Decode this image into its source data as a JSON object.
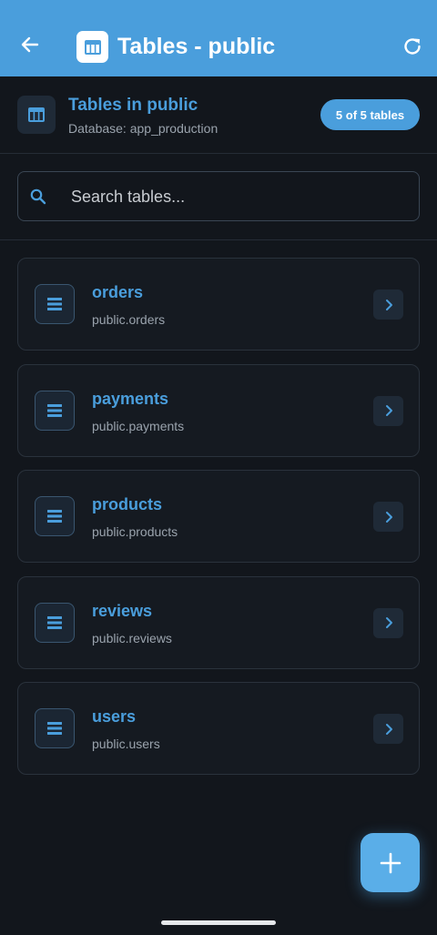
{
  "appbar": {
    "title": "Tables - public",
    "back_icon": "arrow-left-icon",
    "title_icon": "table-icon",
    "refresh_icon": "refresh-icon",
    "color": "#4a9edc"
  },
  "header": {
    "title": "Tables in public",
    "subtitle": "Database: app_production",
    "badge": "5 of 5 tables"
  },
  "search": {
    "placeholder": "Search tables...",
    "value": ""
  },
  "tables": [
    {
      "name": "orders",
      "path": "public.orders"
    },
    {
      "name": "payments",
      "path": "public.payments"
    },
    {
      "name": "products",
      "path": "public.products"
    },
    {
      "name": "reviews",
      "path": "public.reviews"
    },
    {
      "name": "users",
      "path": "public.users"
    }
  ],
  "fab": {
    "icon": "plus-icon"
  },
  "colors": {
    "accent": "#4a9edc",
    "background": "#12161c"
  }
}
